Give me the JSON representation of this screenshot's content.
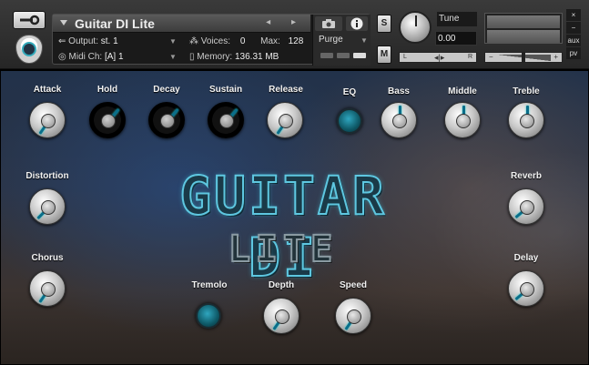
{
  "header": {
    "instrument_title": "Guitar DI Lite",
    "nav_arrows": "◂ ▸",
    "output_label": "Output:",
    "output_value": "st. 1",
    "voices_label": "Voices:",
    "voices_value": "0",
    "max_label": "Max:",
    "max_value": "128",
    "midi_label": "Midi Ch:",
    "midi_value": "[A]  1",
    "memory_label": "Memory:",
    "memory_value": "136.31 MB",
    "purge_label": "Purge",
    "solo_label": "S",
    "mute_label": "M",
    "tune_label": "Tune",
    "tune_value": "0.00",
    "pan_left": "L",
    "pan_right": "R",
    "pan_center": "◂|▸",
    "vol_minus": "−",
    "vol_plus": "+",
    "close_label": "×",
    "minimize_label": "−",
    "aux_label": "aux",
    "pv_label": "pv"
  },
  "controls": {
    "attack": "Attack",
    "hold": "Hold",
    "decay": "Decay",
    "sustain": "Sustain",
    "release": "Release",
    "eq": "EQ",
    "bass": "Bass",
    "middle": "Middle",
    "treble": "Treble",
    "distortion": "Distortion",
    "reverb": "Reverb",
    "chorus": "Chorus",
    "delay": "Delay",
    "tremolo": "Tremolo",
    "depth": "Depth",
    "speed": "Speed"
  },
  "logo": {
    "title": "GUITAR DI",
    "subtitle": "LITE"
  },
  "colors": {
    "accent": "#0a6e8a",
    "led": "#2fa6bf"
  }
}
